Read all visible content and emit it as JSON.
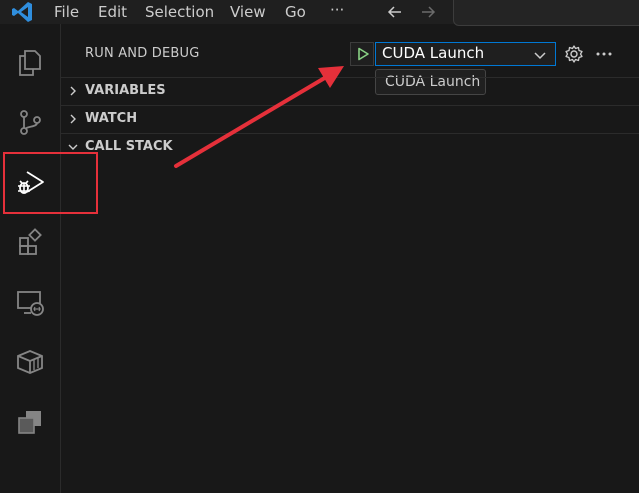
{
  "menu": {
    "items": [
      {
        "label": "File"
      },
      {
        "label": "Edit"
      },
      {
        "label": "Selection"
      },
      {
        "label": "View"
      },
      {
        "label": "Go"
      },
      {
        "label": "···"
      }
    ]
  },
  "activity_bar": {
    "items": [
      {
        "icon": "explorer-icon"
      },
      {
        "icon": "source-control-icon"
      },
      {
        "icon": "run-debug-icon",
        "active": true
      },
      {
        "icon": "extensions-icon"
      },
      {
        "icon": "remote-explorer-icon"
      },
      {
        "icon": "containers-icon"
      },
      {
        "icon": "stacked-windows-icon"
      }
    ]
  },
  "sidebar": {
    "title": "RUN AND DEBUG",
    "config": {
      "selected": "CUDA Launch",
      "tooltip": "CUDA Launch"
    },
    "sections": [
      {
        "label": "VARIABLES",
        "expanded": false
      },
      {
        "label": "WATCH",
        "expanded": false
      },
      {
        "label": "CALL STACK",
        "expanded": true
      }
    ]
  },
  "colors": {
    "accent": "#0078d4",
    "annotation": "#e5303a",
    "play": "#89d185"
  }
}
